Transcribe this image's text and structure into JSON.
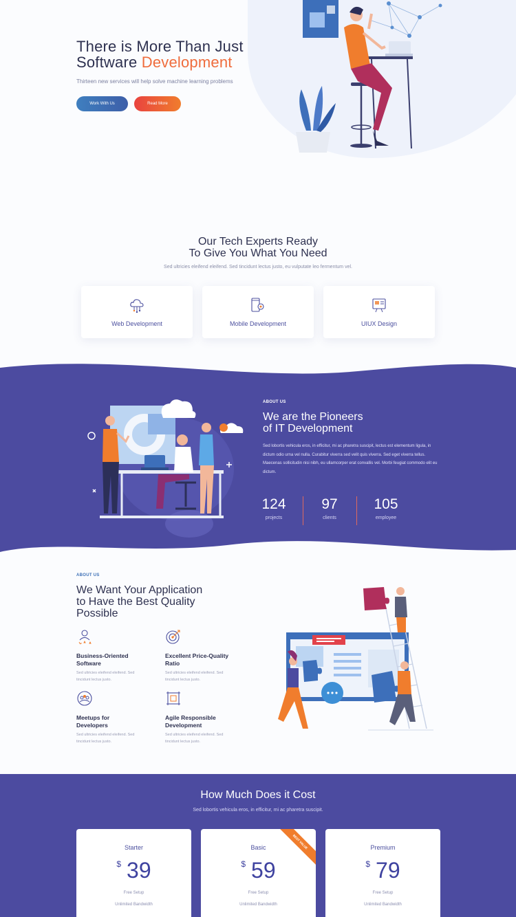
{
  "hero": {
    "title_line1": "There is More Than Just",
    "title_line2_plain": "Software ",
    "title_line2_accent": "Development",
    "subtitle": "Thirteen new services will help solve machine learning problems",
    "btn_work": "Work With Us",
    "btn_read": "Read More",
    "accent_color": "#ef6c3c"
  },
  "services": {
    "title_line1": "Our Tech Experts Ready",
    "title_line2": "To Give You What You Need",
    "subtitle": "Sed ultricies eleifend eleifend. Sed tincidunt lectus justo, eu vulputate leo fermentum vel.",
    "cards": [
      {
        "label": "Web Development",
        "icon": "cloud-network-icon"
      },
      {
        "label": "Mobile Development",
        "icon": "mobile-gear-icon"
      },
      {
        "label": "UIUX Design",
        "icon": "design-board-icon"
      }
    ]
  },
  "about": {
    "label": "ABOUT US",
    "title_line1": "We are the Pioneers",
    "title_line2": "of IT Development",
    "text": "Sed lobortis vehicula eros, in efficitur, mi ac pharetra suscipit, lectus est elementum ligula, in dictum odio urna vel nulla. Curabitur viverra sed velit quis viverra. Sed eget viverra tellus. Maecenas sollicitudin nisi nibh, eu ullamcorper erat convallis vel. Morbi feugiat commodo elit eu dictum.",
    "stats": [
      {
        "value": "124",
        "label": "projects"
      },
      {
        "value": "97",
        "label": "clients"
      },
      {
        "value": "105",
        "label": "employee"
      }
    ],
    "bg_color": "#4c4ba0"
  },
  "features": {
    "label": "ABOUT US",
    "title_line1": "We Want Your Application",
    "title_line2": "to Have the Best Quality",
    "title_line3": "Possible",
    "items": [
      {
        "title_a": "Business-Oriented",
        "title_b": "Software",
        "desc_a": "Sed ultricies eleifend eleifend. Sed",
        "desc_b": "tincidunt lectus justo.",
        "icon": "user-stars-icon"
      },
      {
        "title_a": "Excellent Price-Quality",
        "title_b": "Ratio",
        "desc_a": "Sed ultricies eleifend eleifend. Sed",
        "desc_b": "tincidunt lectus justo.",
        "icon": "target-icon"
      },
      {
        "title_a": "Meetups for",
        "title_b": "Developers",
        "desc_a": "Sed ultricies eleifend eleifend. Sed",
        "desc_b": "tincidunt lectus justo.",
        "icon": "people-circle-icon"
      },
      {
        "title_a": "Agile Responsible",
        "title_b": "Development",
        "desc_a": "Sed ultricies eleifend eleifend. Sed",
        "desc_b": "tincidunt lectus justo.",
        "icon": "frame-icon"
      }
    ]
  },
  "pricing": {
    "title": "How Much Does it Cost",
    "subtitle": "Sed lobortis vehicula eros, in efficitur, mi ac pharetra suscipit.",
    "currency": "$",
    "plans": [
      {
        "name": "Starter",
        "price": "39",
        "f1": "Free Setup",
        "f2": "Unlimited Bandwidth"
      },
      {
        "name": "Basic",
        "price": "59",
        "f1": "Free Setup",
        "f2": "Unlimited Bandwidth",
        "ribbon": "BEST VALUE"
      },
      {
        "name": "Premium",
        "price": "79",
        "f1": "Free Setup",
        "f2": "Unlimited Bandwidth"
      }
    ]
  }
}
